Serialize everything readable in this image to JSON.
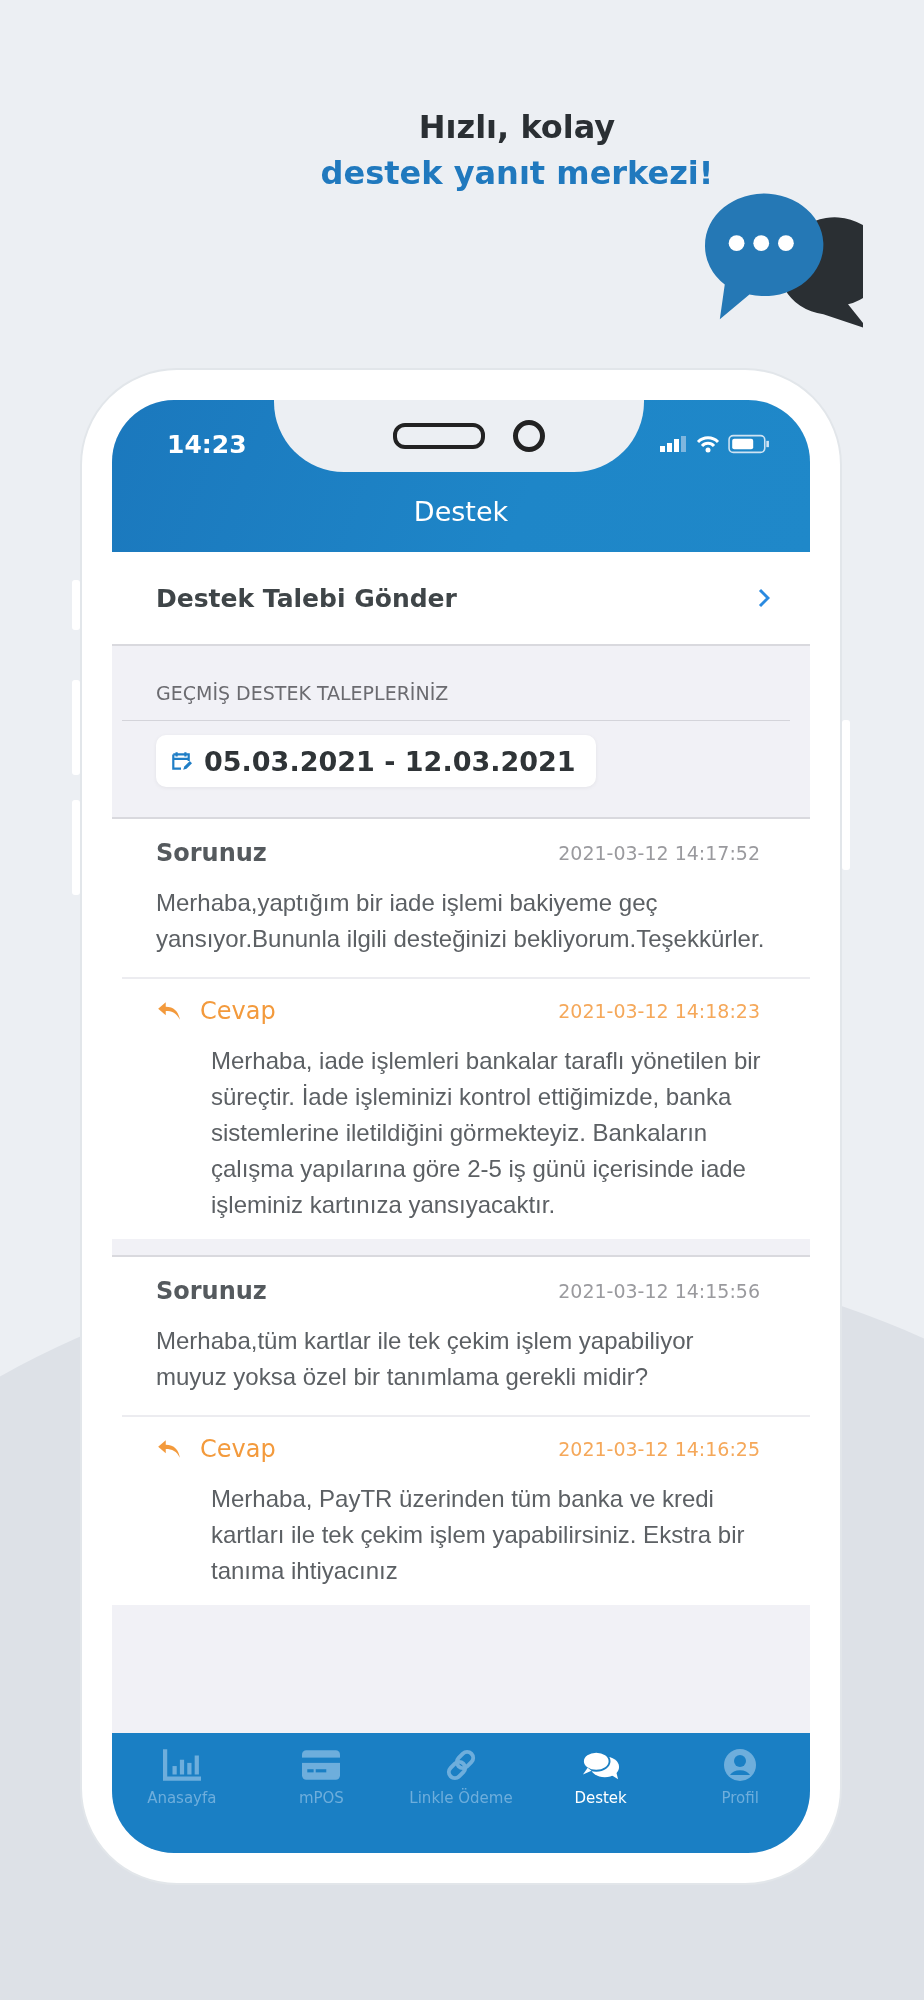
{
  "promo": {
    "line_1": "Hızlı, kolay",
    "line_2": "destek yanıt merkezi!"
  },
  "status_bar": {
    "time": "14:23"
  },
  "header": {
    "title": "Destek"
  },
  "send_request": {
    "label": "Destek Talebi Gönder"
  },
  "history": {
    "label": "GEÇMİŞ DESTEK TALEPLERİNİZ",
    "date_range": "05.03.2021 - 12.03.2021"
  },
  "tickets": [
    {
      "question_label": "Sorunuz",
      "question_time": "2021-03-12 14:17:52",
      "question": "Merhaba,yaptığım bir iade işlemi bakiyeme geç yansıyor.Bununla ilgili desteğinizi bekliyorum.Teşekkürler.",
      "answer_label": "Cevap",
      "answer_time": "2021-03-12 14:18:23",
      "answer": "Merhaba, iade işlemleri bankalar taraflı yönetilen bir süreçtir. İade işleminizi kontrol ettiğimizde, banka sistemlerine iletildiğini görmekteyiz. Bankaların çalışma yapılarına göre 2-5 iş günü içerisinde iade işleminiz kartınıza yansıyacaktır."
    },
    {
      "question_label": "Sorunuz",
      "question_time": "2021-03-12 14:15:56",
      "question": "Merhaba,tüm kartlar ile tek çekim işlem yapabiliyor muyuz yoksa özel bir tanımlama gerekli midir?",
      "answer_label": "Cevap",
      "answer_time": "2021-03-12 14:16:25",
      "answer": "Merhaba, PayTR üzerinden tüm banka ve kredi kartları ile tek çekim işlem yapabilirsiniz. Ekstra bir tanıma ihtiyacınız"
    }
  ],
  "tab_bar": [
    {
      "kind": "chart",
      "label": "Anasayfa",
      "selected": false
    },
    {
      "kind": "card",
      "label": "mPOS",
      "selected": false
    },
    {
      "kind": "link",
      "label": "Linkle Ödeme",
      "selected": false
    },
    {
      "kind": "chat",
      "label": "Destek",
      "selected": true
    },
    {
      "kind": "profile",
      "label": "Profil",
      "selected": false
    }
  ]
}
